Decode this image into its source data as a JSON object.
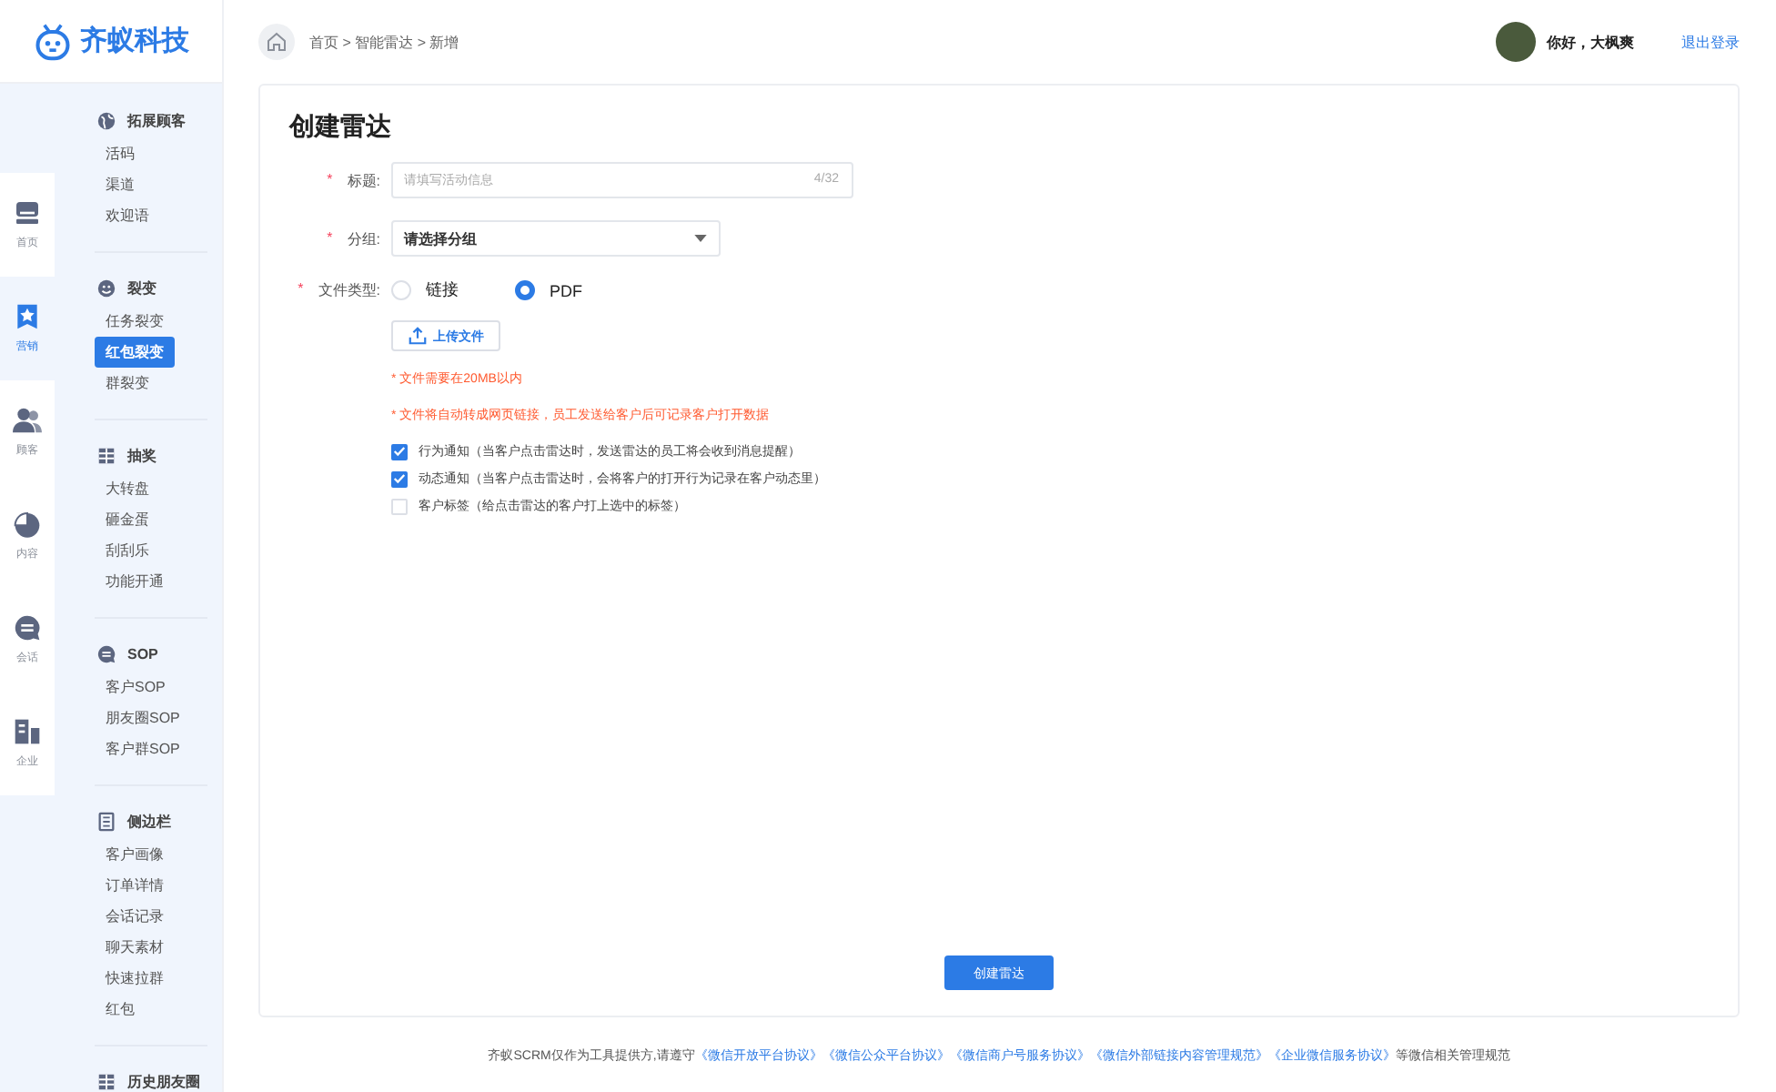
{
  "logo": {
    "text": "齐蚁科技"
  },
  "breadcrumb": [
    "首页 > 智能雷达 > 新增"
  ],
  "user": {
    "greeting": "你好，大枫爽",
    "logout": "退出登录"
  },
  "rail": [
    {
      "label": "首页",
      "selected": false
    },
    {
      "label": "营销",
      "selected": true
    },
    {
      "label": "顾客",
      "selected": false
    },
    {
      "label": "内容",
      "selected": false
    },
    {
      "label": "会话",
      "selected": false
    },
    {
      "label": "企业",
      "selected": false
    }
  ],
  "menu": [
    {
      "title": "拓展顾客",
      "items": [
        {
          "label": "活码",
          "selected": false
        },
        {
          "label": "渠道",
          "selected": false
        },
        {
          "label": "欢迎语",
          "selected": false
        }
      ]
    },
    {
      "title": "裂变",
      "items": [
        {
          "label": "任务裂变",
          "selected": false
        },
        {
          "label": "红包裂变",
          "selected": true
        },
        {
          "label": "群裂变",
          "selected": false
        }
      ]
    },
    {
      "title": "抽奖",
      "items": [
        {
          "label": "大转盘",
          "selected": false
        },
        {
          "label": "砸金蛋",
          "selected": false
        },
        {
          "label": "刮刮乐",
          "selected": false
        },
        {
          "label": "功能开通",
          "selected": false
        }
      ]
    },
    {
      "title": "SOP",
      "items": [
        {
          "label": "客户SOP",
          "selected": false
        },
        {
          "label": "朋友圈SOP",
          "selected": false
        },
        {
          "label": "客户群SOP",
          "selected": false
        }
      ]
    },
    {
      "title": "侧边栏",
      "items": [
        {
          "label": "客户画像",
          "selected": false
        },
        {
          "label": "订单详情",
          "selected": false
        },
        {
          "label": "会话记录",
          "selected": false
        },
        {
          "label": "聊天素材",
          "selected": false
        },
        {
          "label": "快速拉群",
          "selected": false
        },
        {
          "label": "红包",
          "selected": false
        }
      ]
    },
    {
      "title": "历史朋友圈"
    }
  ],
  "form": {
    "title": "创建雷达",
    "title_field": {
      "required": true,
      "label": "标题:",
      "placeholder": "请填写活动信息",
      "counter": "4/32"
    },
    "group_field": {
      "required": true,
      "label": "分组:",
      "value": "请选择分组"
    },
    "file_type": {
      "required": true,
      "label": "文件类型:",
      "options": [
        {
          "label": "链接",
          "selected": false
        },
        {
          "label": "PDF",
          "selected": true
        }
      ]
    },
    "upload": "上传文件",
    "notes": [
      "* 文件需要在20MB以内",
      "* 文件将自动转成网页链接，员工发送给客户后可记录客户打开数据"
    ],
    "required_mark": "*",
    "checks": [
      {
        "label": "行为通知（当客户点击雷达时，发送雷达的员工将会收到消息提醒）",
        "checked": true
      },
      {
        "label": "动态通知（当客户点击雷达时，会将客户的打开行为记录在客户动态里）",
        "checked": true
      },
      {
        "label": "客户标签（给点击雷达的客户打上选中的标签）",
        "checked": false
      }
    ],
    "submit": "创建雷达"
  },
  "footer": {
    "prefix": "齐蚁SCRM仅作为工具提供方,请遵守",
    "links": [
      "《微信开放平台协议》",
      "《微信公众平台协议》",
      "《微信商户号服务协议》",
      "《微信外部链接内容管理规范》",
      "《企业微信服务协议》"
    ],
    "suffix": "等微信相关管理规范"
  }
}
